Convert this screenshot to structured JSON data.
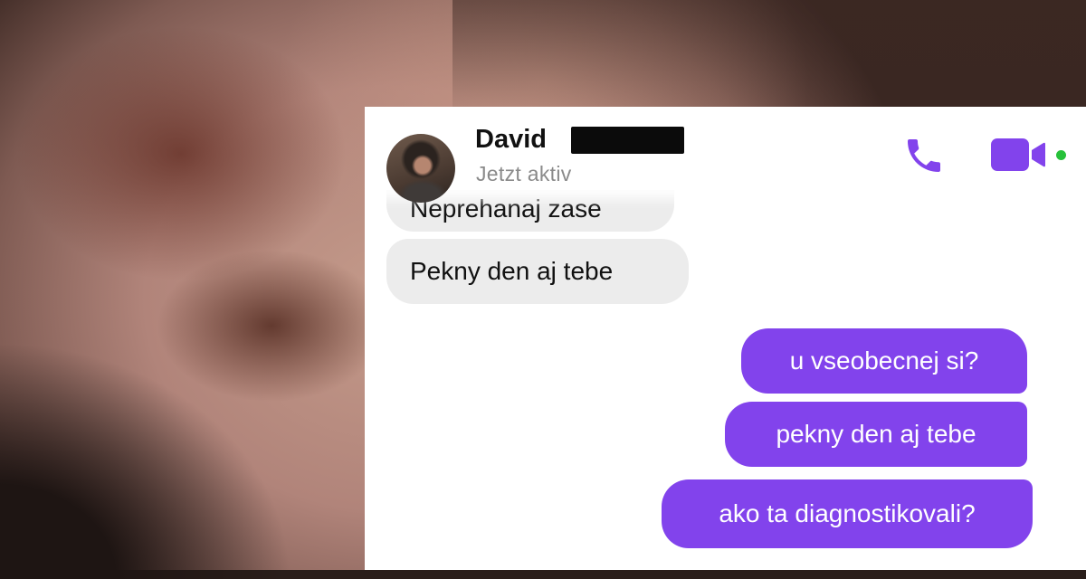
{
  "chat": {
    "contact_name": "David",
    "status": "Jetzt aktiv",
    "call_icon": "phone-icon",
    "video_icon": "video-camera-icon",
    "accent_color": "#8243ec",
    "online_color": "#27c13a"
  },
  "messages": [
    {
      "direction": "incoming",
      "text": "Neprehanaj zase"
    },
    {
      "direction": "incoming",
      "text": "Pekny den aj tebe"
    },
    {
      "direction": "outgoing",
      "text": "u vseobecnej si?"
    },
    {
      "direction": "outgoing",
      "text": "pekny den aj tebe"
    },
    {
      "direction": "outgoing",
      "text": "ako ta diagnostikovali?"
    }
  ]
}
